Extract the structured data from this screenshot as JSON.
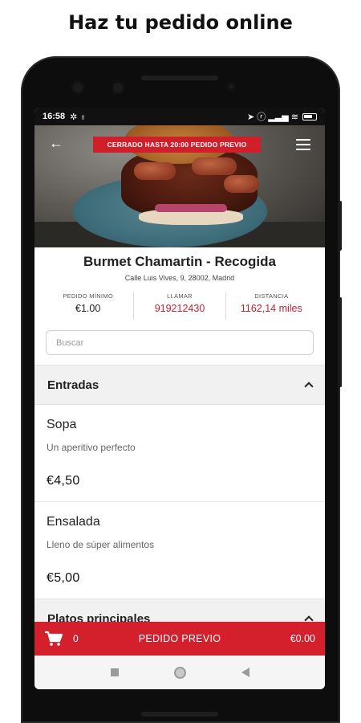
{
  "headline": "Haz tu pedido online",
  "status_bar": {
    "time": "16:58",
    "left_icons": "✲ ♁",
    "right_icons": "➤ ⓡ ▂▃▅ ≋"
  },
  "hero": {
    "banner": "CERRADO HASTA 20:00 PEDIDO PREVIO",
    "back_icon": "←"
  },
  "restaurant": {
    "name": "Burmet Chamartin - Recogida",
    "address": "Calle Luis Vives, 9, 28002, Madrid"
  },
  "info": [
    {
      "label": "PEDIDO MÍNIMO",
      "value": "€1.00"
    },
    {
      "label": "LLAMAR",
      "value": "919212430"
    },
    {
      "label": "DISTANCIA",
      "value": "1162,14  miles"
    }
  ],
  "search": {
    "placeholder": "Buscar"
  },
  "sections": [
    {
      "title": "Entradas",
      "items": [
        {
          "name": "Sopa",
          "description": "Un aperitivo perfecto",
          "price": "€4,50"
        },
        {
          "name": "Ensalada",
          "description": "Lleno de súper alimentos",
          "price": "€5,00"
        }
      ]
    },
    {
      "title": "Platos principales"
    }
  ],
  "cart": {
    "count": "0",
    "action": "PEDIDO PREVIO",
    "total": "€0.00"
  },
  "colors": {
    "brand_red": "#d41f2d",
    "text_red": "#c4212c"
  }
}
